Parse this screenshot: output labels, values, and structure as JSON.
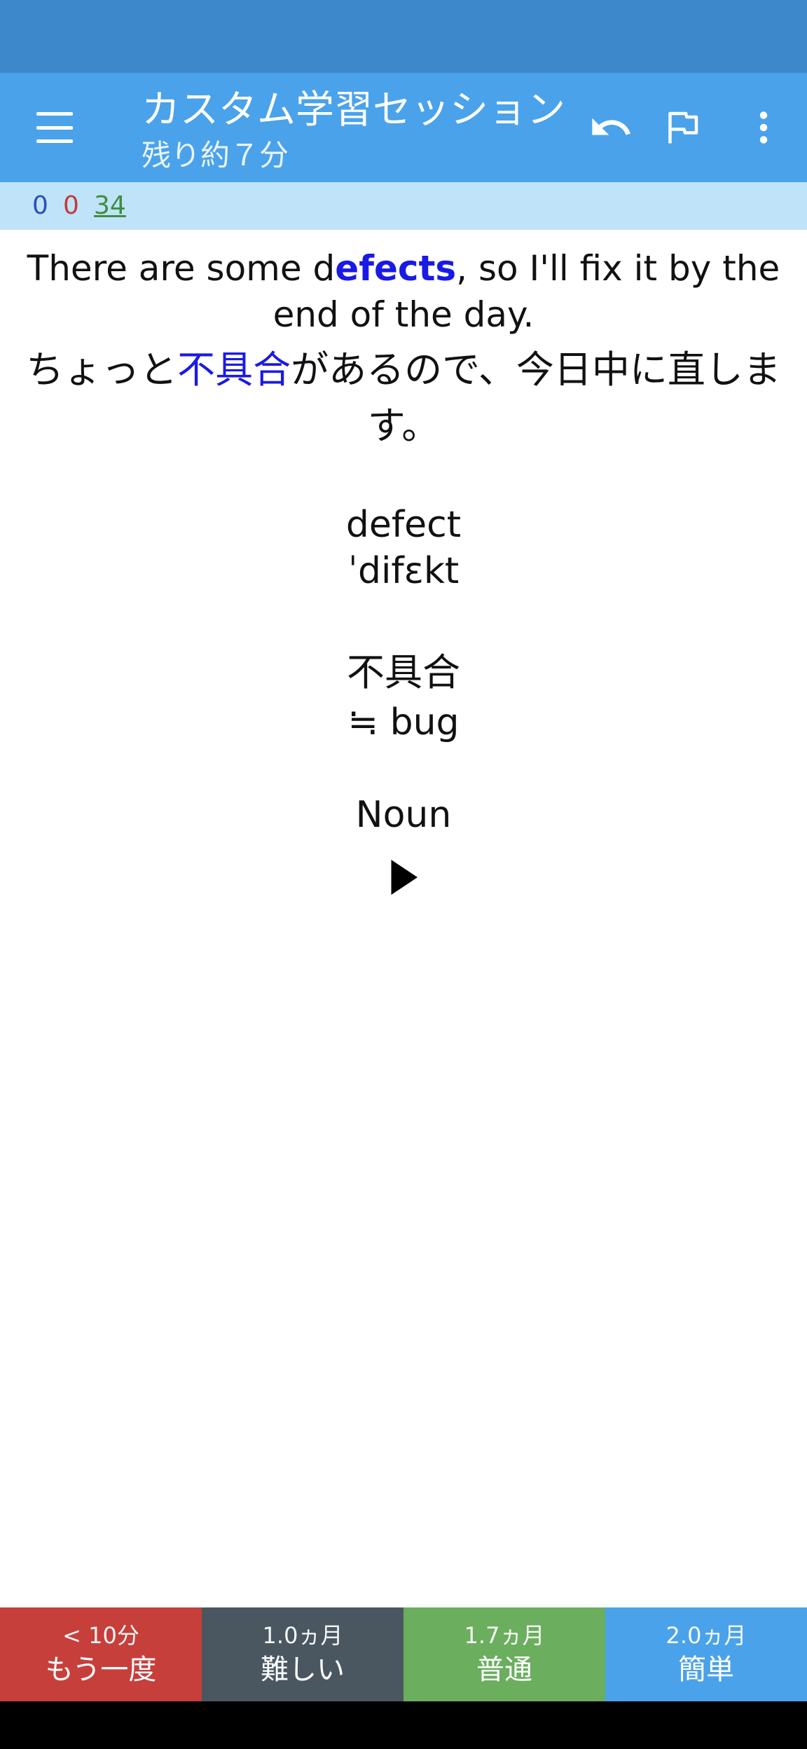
{
  "app_bar": {
    "title": "カスタム学習セッション",
    "subtitle": "残り約７分",
    "colors": {
      "background": "#4aa2ea",
      "status_bar": "#3d88ca"
    },
    "icons": [
      "menu-icon",
      "undo-icon",
      "flag-icon",
      "more-vert-icon"
    ]
  },
  "counts": {
    "new": "0",
    "learning": "0",
    "review": "34",
    "colors": {
      "new": "#2b4fb5",
      "learning": "#c23b3b",
      "review": "#3e8f3e"
    }
  },
  "card": {
    "sentence_en_pre": "There are some d",
    "sentence_en_highlight": "efects",
    "sentence_en_post": ", so I'll fix it by the end of the day.",
    "sentence_ja_pre": "ちょっと",
    "sentence_ja_highlight": "不具合",
    "sentence_ja_post": "があるので、今日中に直します。",
    "word": "defect",
    "ipa": "ˈdifɛkt",
    "meaning": "不具合",
    "synonym": "≒ bug",
    "part_of_speech": "Noun",
    "highlight_color": "#1a1ae6",
    "play_icon": "play-icon"
  },
  "answers": [
    {
      "interval": "< 10分",
      "label": "もう一度",
      "color": "#c63f3b"
    },
    {
      "interval": "1.0ヵ月",
      "label": "難しい",
      "color": "#4a5761"
    },
    {
      "interval": "1.7ヵ月",
      "label": "普通",
      "color": "#6aae5e"
    },
    {
      "interval": "2.0ヵ月",
      "label": "簡単",
      "color": "#4aa2ea"
    }
  ]
}
